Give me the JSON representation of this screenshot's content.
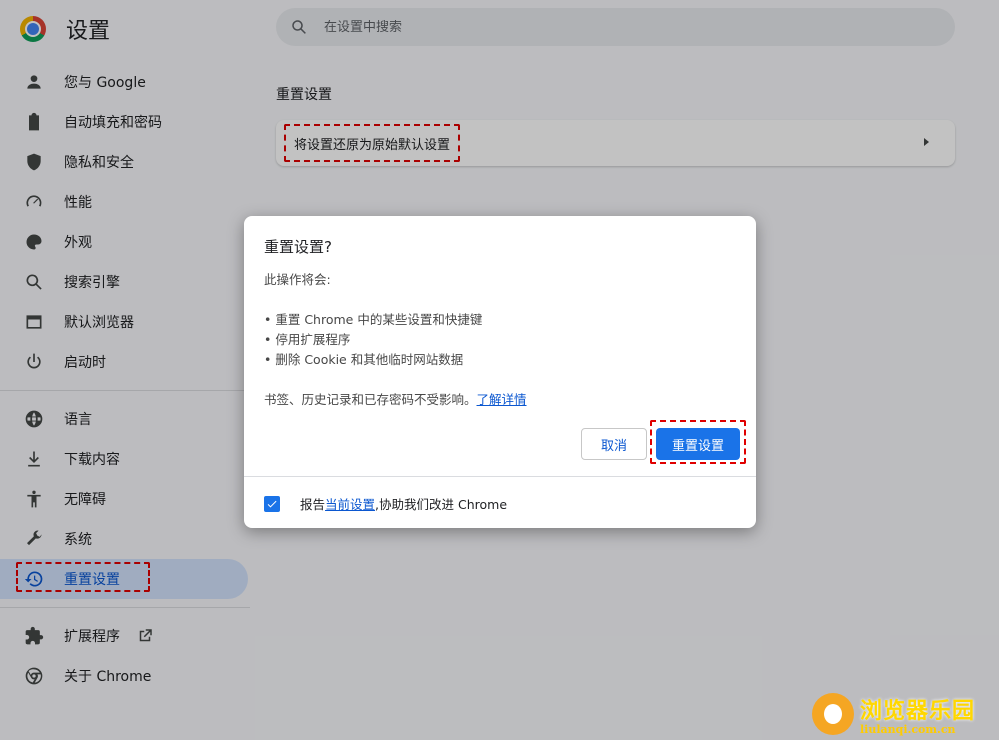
{
  "app": {
    "title": "设置"
  },
  "search": {
    "placeholder": "在设置中搜索"
  },
  "sidebar": {
    "items": [
      {
        "label": "您与 Google",
        "icon": "person-icon"
      },
      {
        "label": "自动填充和密码",
        "icon": "clipboard-icon"
      },
      {
        "label": "隐私和安全",
        "icon": "shield-icon"
      },
      {
        "label": "性能",
        "icon": "speedometer-icon"
      },
      {
        "label": "外观",
        "icon": "palette-icon"
      },
      {
        "label": "搜索引擎",
        "icon": "search-icon"
      },
      {
        "label": "默认浏览器",
        "icon": "browser-window-icon"
      },
      {
        "label": "启动时",
        "icon": "power-icon"
      },
      {
        "label": "语言",
        "icon": "globe-icon"
      },
      {
        "label": "下载内容",
        "icon": "download-icon"
      },
      {
        "label": "无障碍",
        "icon": "accessibility-icon"
      },
      {
        "label": "系统",
        "icon": "wrench-icon"
      },
      {
        "label": "重置设置",
        "icon": "restore-icon"
      },
      {
        "label": "扩展程序",
        "icon": "puzzle-icon"
      },
      {
        "label": "关于 Chrome",
        "icon": "chrome-icon"
      }
    ]
  },
  "main": {
    "section_title": "重置设置",
    "reset_row_label": "将设置还原为原始默认设置"
  },
  "dialog": {
    "title": "重置设置?",
    "intro": "此操作将会:",
    "bullets": [
      "• 重置 Chrome 中的某些设置和快捷键",
      "• 停用扩展程序",
      "• 删除 Cookie 和其他临时网站数据"
    ],
    "note": "书签、历史记录和已存密码不受影响。",
    "learn_more": "了解详情",
    "cancel_label": "取消",
    "confirm_label": "重置设置",
    "report_prefix": "报告",
    "report_link": "当前设置",
    "report_suffix": ",协助我们改进 Chrome",
    "report_checked": true
  },
  "watermark": {
    "cn": "浏览器乐园",
    "en": "liulanqi.com.cn"
  },
  "colors": {
    "accent": "#1a73e8",
    "active_bg": "#d3e3fd",
    "highlight": "#e00000"
  }
}
